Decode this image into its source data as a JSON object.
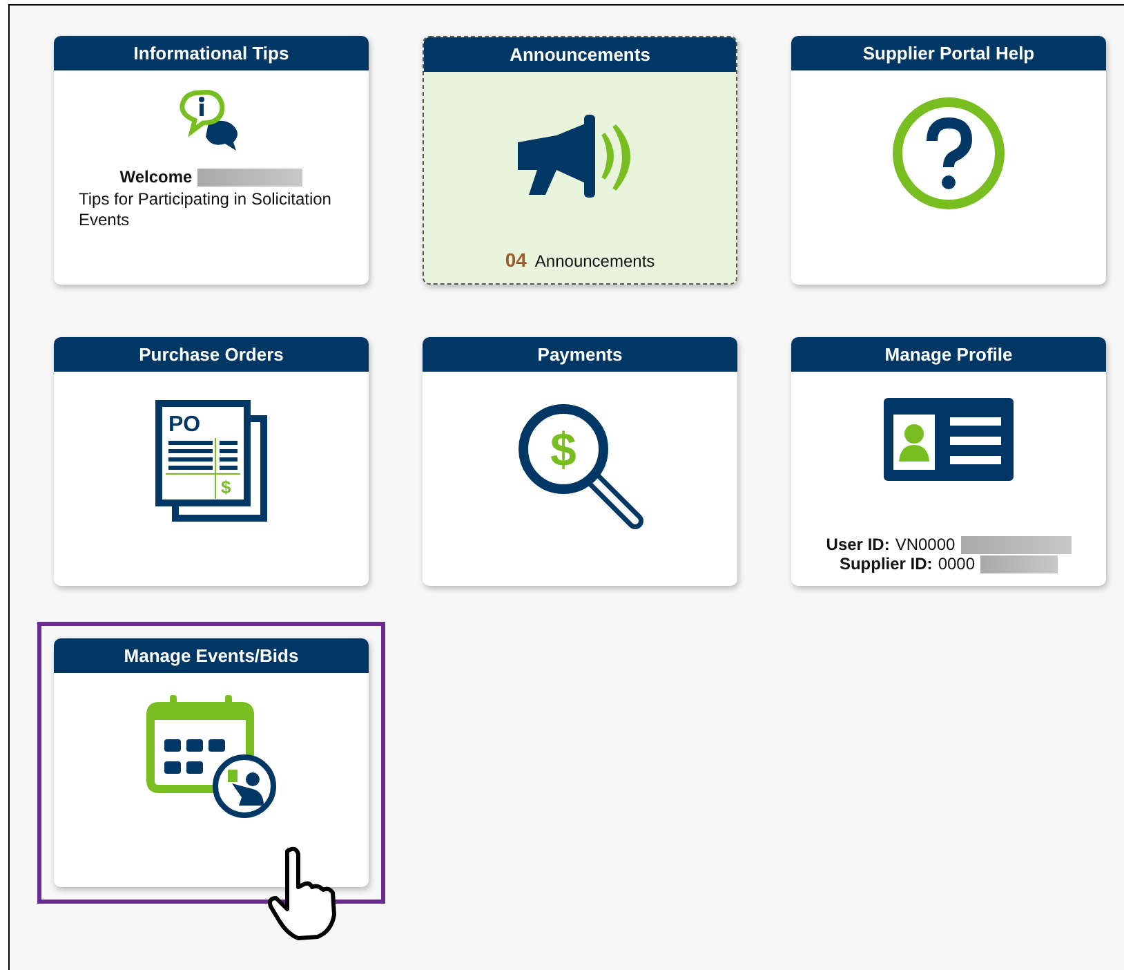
{
  "tiles": [
    {
      "title": "Informational Tips",
      "kind": "info",
      "highlighted": false,
      "focused": false,
      "pointer": false,
      "welcome": "Welcome",
      "welcome_redacted": true,
      "text": "Tips for Participating in Solicitation Events"
    },
    {
      "title": "Announcements",
      "kind": "announcements",
      "highlighted": true,
      "focused": false,
      "pointer": false,
      "count": "04",
      "count_label": "Announcements"
    },
    {
      "title": "Supplier Portal Help",
      "kind": "help",
      "highlighted": false,
      "focused": false,
      "pointer": false
    },
    {
      "title": "Purchase Orders",
      "kind": "purchase_orders",
      "highlighted": false,
      "focused": false,
      "pointer": false,
      "icon_label": "PO",
      "icon_symbol": "$"
    },
    {
      "title": "Payments",
      "kind": "payments",
      "highlighted": false,
      "focused": false,
      "pointer": false,
      "icon_symbol": "$"
    },
    {
      "title": "Manage Profile",
      "kind": "profile",
      "highlighted": false,
      "focused": false,
      "pointer": false,
      "ids": [
        {
          "label": "User ID:",
          "value": "VN0000",
          "redacted": true
        },
        {
          "label": "Supplier ID:",
          "value": "0000",
          "redacted": true
        }
      ]
    },
    {
      "title": "Manage Events/Bids",
      "kind": "events",
      "highlighted": false,
      "focused": true,
      "pointer": true
    }
  ]
}
